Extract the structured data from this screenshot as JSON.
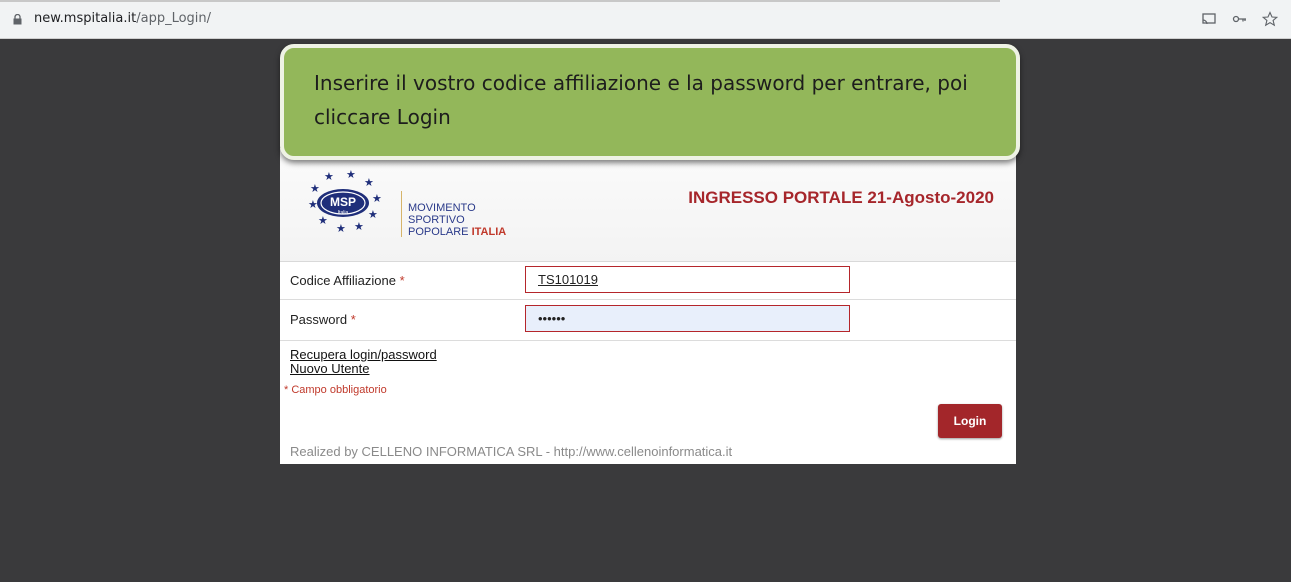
{
  "browser": {
    "url_host": "new.mspitalia.it",
    "url_path": "/app_Login/",
    "icons": [
      "lock-icon",
      "cast-icon",
      "key-icon",
      "star-icon"
    ]
  },
  "callout": {
    "text": "Inserire il vostro codice affiliazione e la password per entrare, poi cliccare Login",
    "color": "#93b75a"
  },
  "header": {
    "logo_text": "MSP",
    "logo_sub": "Italia",
    "org_line1": "MOVIMENTO",
    "org_line2": "SPORTIVO",
    "org_line3a": "POPOLARE ",
    "org_line3b": "ITALIA",
    "portal_title": "INGRESSO PORTALE 21-Agosto-2020"
  },
  "form": {
    "codice_label": "Codice Affiliazione",
    "codice_value": "TS101019",
    "password_label": "Password",
    "password_value": "••••••",
    "required_mark": " *",
    "recover_link": "Recupera login/password",
    "new_user_link": "Nuovo Utente",
    "mandatory_note": "* Campo obbligatorio",
    "login_button": "Login"
  },
  "footer": {
    "text": "Realized by CELLENO INFORMATICA SRL - http://www.cellenoinformatica.it"
  },
  "colors": {
    "accent": "#a3262a",
    "background": "#3a3a3c"
  }
}
